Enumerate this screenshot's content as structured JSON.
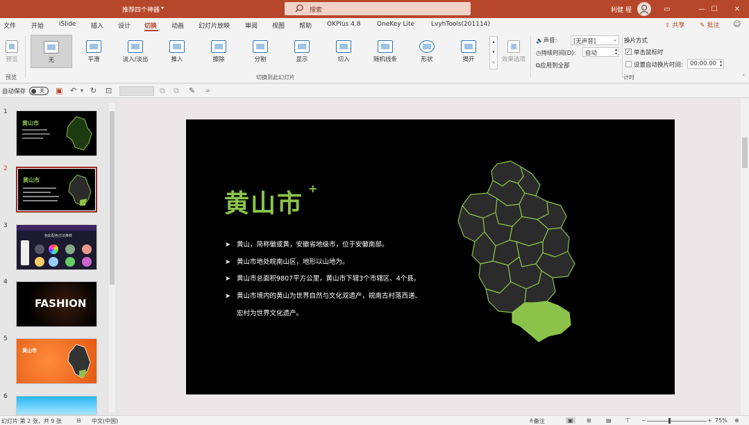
{
  "window": {
    "doc_title": "推荐四个神器",
    "search_placeholder": "搜索",
    "user_name": "利健 程",
    "controls": [
      "▭",
      "—",
      "☐",
      "✕"
    ]
  },
  "menu": {
    "tabs": [
      "文件",
      "开始",
      "iSlide",
      "插入",
      "设计",
      "切换",
      "动画",
      "幻灯片放映",
      "审阅",
      "视图",
      "帮助",
      "OKPlus 4.8",
      "OneKey Lite",
      "LvyhTools(201114)"
    ],
    "active_tab": "切换",
    "share": "共享",
    "comment": "批注"
  },
  "ribbon": {
    "preview": "预览",
    "preview_group": "预览",
    "transitions": [
      "无",
      "平滑",
      "淡入/淡出",
      "推入",
      "擦除",
      "分割",
      "显示",
      "切入",
      "随机线条",
      "形状",
      "揭开"
    ],
    "effect_options": "效果选项",
    "transition_group": "切换到此幻灯片",
    "sound_label": "声音:",
    "sound_value": "[无声音]",
    "duration_label": "持续时间(D):",
    "duration_value": "自动",
    "apply_all": "应用到全部",
    "advance_title": "换片方式",
    "on_click": "单击鼠标时",
    "after_label": "设置自动换片时间:",
    "after_value": "00:00.00",
    "timing_group": "计时"
  },
  "qat": {
    "autosave": "自动保存",
    "toggle": "关"
  },
  "slides": {
    "numbers": [
      "1",
      "2",
      "3",
      "4",
      "5",
      "6"
    ],
    "selected": 2,
    "thumb1_title": "黄山市",
    "thumb2_title": "黄山市",
    "thumb3_title": "色彩配色方法推荐",
    "thumb4_title": "FASHION",
    "thumb5_title": "黄山市"
  },
  "slide": {
    "title": "黄山市",
    "title_plus": "+",
    "bullets": [
      "黄山，简称徽或黄，安徽省地级市，位于安徽南部。",
      "黄山市地处皖南山区，地形以山地为。",
      "黄山市总面积9807平方公里，黄山市下辖3个市辖区、4个县。",
      "黄山市境内的黄山为世界自然与文化双遗产，皖南古村落西递、",
      "宏村为世界文化遗产。"
    ],
    "bullet_arrow": "➤"
  },
  "status": {
    "slide_info": "幻灯片 第 2 张，共 9 张",
    "language": "中文(中国)",
    "notes": "备注",
    "zoom": "75%"
  },
  "colors": {
    "accent": "#b7472a",
    "slide_bg": "#000000",
    "highlight_green": "#8bc34a",
    "map_fill": "#2b2b2b"
  }
}
